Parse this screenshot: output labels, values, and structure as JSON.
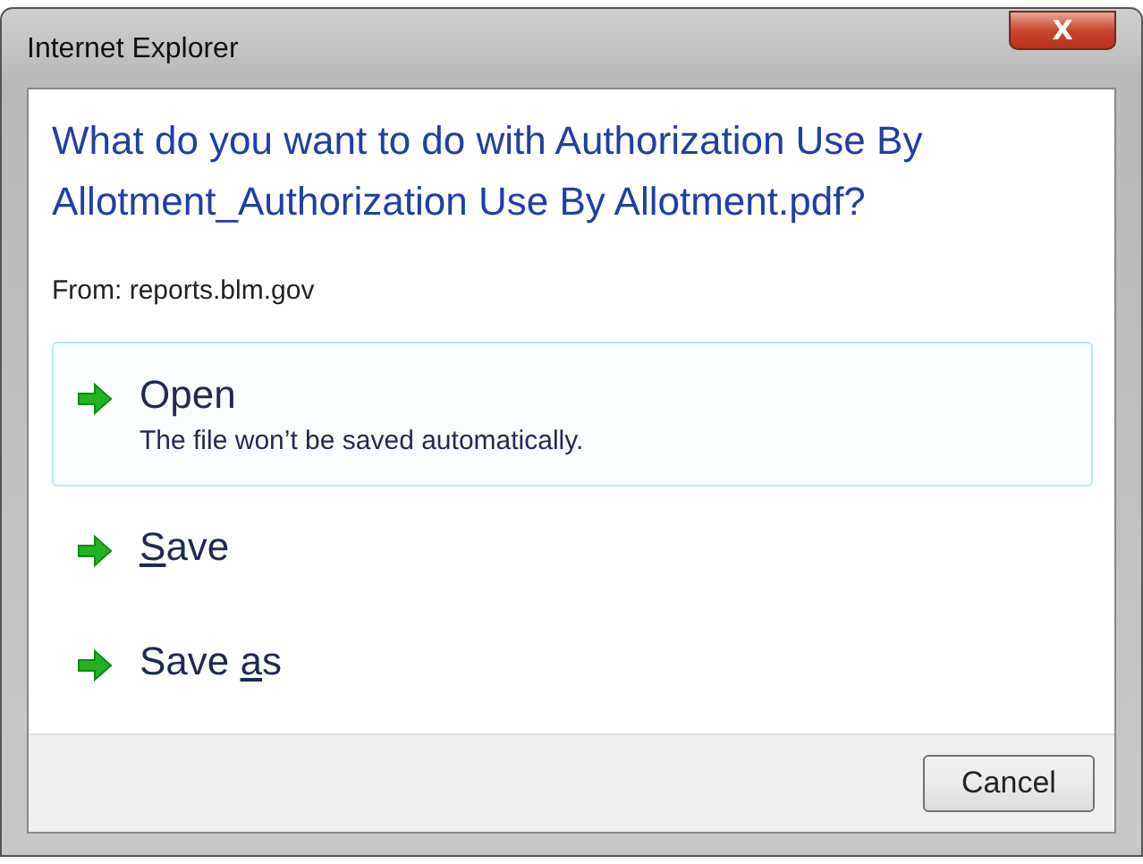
{
  "window": {
    "title": "Internet Explorer",
    "close_button": "X"
  },
  "question": "What do you want to do with Authorization Use By Allotment_Authorization Use By Allotment.pdf?",
  "source": "From: reports.blm.gov",
  "options": [
    {
      "label_parts": [
        {
          "text": "Open",
          "underlined": false
        }
      ],
      "description": "The file won’t be saved automatically.",
      "selected": true
    },
    {
      "label_parts": [
        {
          "text": "S",
          "underlined": true
        },
        {
          "text": "ave",
          "underlined": false
        }
      ],
      "selected": false
    },
    {
      "label_parts": [
        {
          "text": "Save ",
          "underlined": false
        },
        {
          "text": "a",
          "underlined": true
        },
        {
          "text": "s",
          "underlined": false
        }
      ],
      "selected": false
    }
  ],
  "buttons": [
    "Cancel"
  ]
}
